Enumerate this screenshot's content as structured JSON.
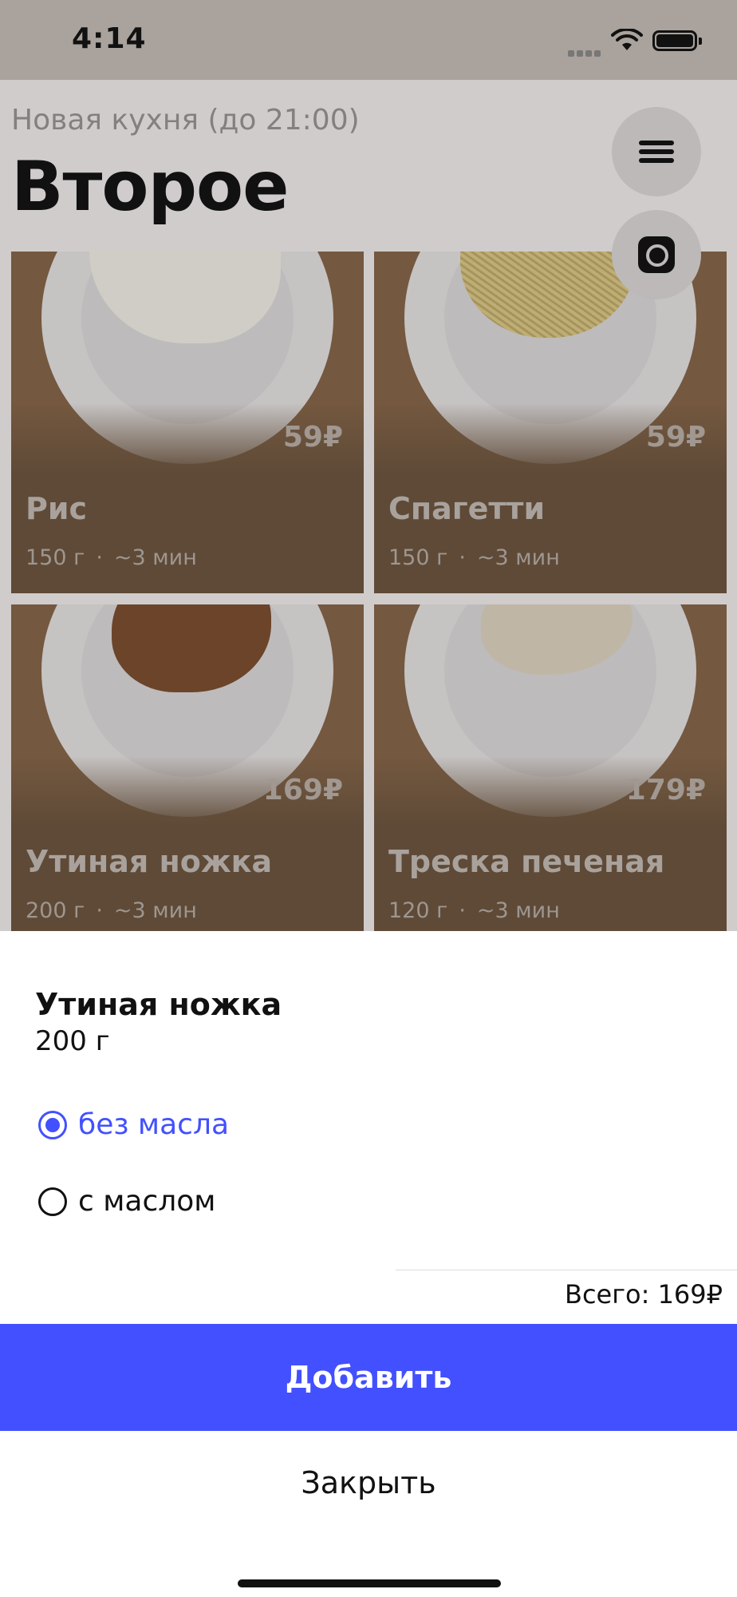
{
  "status_bar": {
    "time": "4:14"
  },
  "header": {
    "subtitle": "Новая кухня (до 21:00)",
    "title": "Второе",
    "menu_icon": "hamburger-menu-icon",
    "camera_icon": "camera-icon"
  },
  "dishes": [
    {
      "name": "Рис",
      "price": "59₽",
      "weight": "150 г",
      "time": "~3 мин",
      "image": "rice-photo"
    },
    {
      "name": "Спагетти",
      "price": "59₽",
      "weight": "150 г",
      "time": "~3 мин",
      "image": "spaghetti-photo"
    },
    {
      "name": "Утиная ножка",
      "price": "169₽",
      "weight": "200 г",
      "time": "~3 мин",
      "image": "duck-leg-photo"
    },
    {
      "name": "Треска печеная",
      "price": "179₽",
      "weight": "120 г",
      "time": "~3 мин",
      "image": "baked-cod-photo"
    }
  ],
  "meta_separator": "·",
  "sheet": {
    "item_name": "Утиная ножка",
    "item_weight": "200 г",
    "options": [
      {
        "label": "без масла",
        "selected": true
      },
      {
        "label": "с маслом",
        "selected": false
      }
    ],
    "total": "Всего: 169₽",
    "add_label": "Добавить",
    "close_label": "Закрыть"
  },
  "colors": {
    "accent": "#4250ff",
    "card_background": "#5e4a37",
    "overlay_dim": "#d0cccc"
  }
}
